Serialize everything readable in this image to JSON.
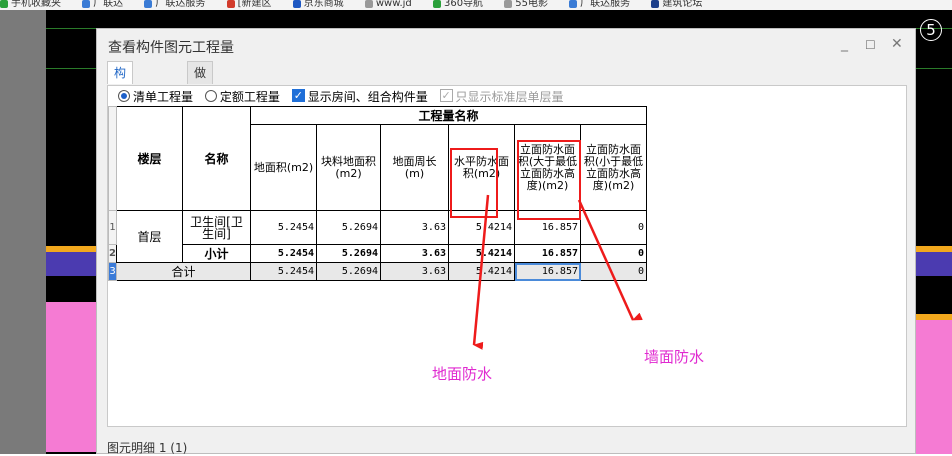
{
  "bookmarks": [
    {
      "label": "手机收藏夹",
      "color": "#2aa03a"
    },
    {
      "label": "广联达",
      "color": "#3a7bd5"
    },
    {
      "label": "广联达服务",
      "color": "#3a7bd5"
    },
    {
      "label": "[新建区",
      "color": "#d23b2b"
    },
    {
      "label": "京东商城",
      "color": "#1d57c2"
    },
    {
      "label": "www.jd",
      "color": "#999999"
    },
    {
      "label": "360导航",
      "color": "#2aa03a"
    },
    {
      "label": "55电影",
      "color": "#999999"
    },
    {
      "label": "广联达服务",
      "color": "#3a7bd5"
    },
    {
      "label": "建筑论坛",
      "color": "#1d3f8a"
    }
  ],
  "canvas": {
    "axis_label": "5"
  },
  "dialog": {
    "title": "查看构件图元工程量",
    "minimize": "_",
    "maximize": "☐",
    "close": "✕",
    "tabs": [
      "构件工程量",
      "做法工程量"
    ],
    "options": {
      "radio_list": "清单工程量",
      "radio_quota": "定额工程量",
      "check_show_rooms": "显示房间、组合构件量",
      "check_std_floor": "只显示标准层单层量"
    },
    "table": {
      "group_header": "工程量名称",
      "col_floor": "楼层",
      "col_name": "名称",
      "headers": [
        "地面积(m2)",
        "块料地面积(m2)",
        "地面周长(m)",
        "水平防水面积(m2)",
        "立面防水面积(大于最低立面防水高度)(m2)",
        "立面防水面积(小于最低立面防水高度)(m2)"
      ],
      "rows": [
        {
          "num": "1",
          "floor": "首层",
          "name": "卫生间[卫生间]",
          "values": [
            "5.2454",
            "5.2694",
            "3.63",
            "5.4214",
            "16.857",
            "0"
          ]
        },
        {
          "num": "2",
          "name": "小计",
          "values": [
            "5.2454",
            "5.2694",
            "3.63",
            "5.4214",
            "16.857",
            "0"
          ]
        },
        {
          "num": "3",
          "name": "合计",
          "values": [
            "5.2454",
            "5.2694",
            "3.63",
            "5.4214",
            "16.857",
            "0"
          ]
        }
      ]
    },
    "footer_label": "图元明细 1 (1)"
  },
  "annotations": {
    "floor_waterproof": "地面防水",
    "wall_waterproof": "墙面防水"
  },
  "colors": {
    "annotation": "#e02ad0",
    "highlight": "#ee1b1b",
    "accent": "#1f66c6"
  }
}
